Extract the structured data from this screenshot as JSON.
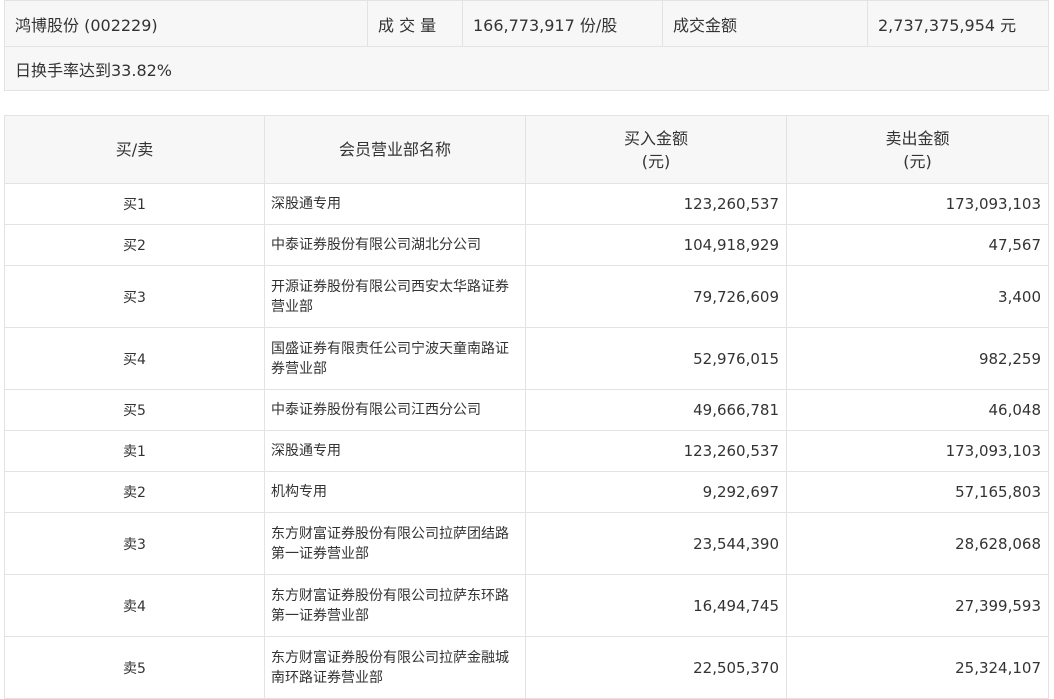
{
  "summary": {
    "stock_name": "鸿博股份 (002229)",
    "volume_label": "成 交 量",
    "volume_value": "166,773,917 份/股",
    "amount_label": "成交金额",
    "amount_value": "2,737,375,954 元",
    "turnover_note": "日换手率达到33.82%"
  },
  "table": {
    "headers": {
      "side": "买/卖",
      "broker": "会员营业部名称",
      "buy_line1": "买入金额",
      "buy_line2": "(元)",
      "sell_line1": "卖出金额",
      "sell_line2": "(元)"
    },
    "rows": [
      {
        "side": "买1",
        "broker": "深股通专用",
        "buy": "123,260,537",
        "sell": "173,093,103"
      },
      {
        "side": "买2",
        "broker": "中泰证券股份有限公司湖北分公司",
        "buy": "104,918,929",
        "sell": "47,567"
      },
      {
        "side": "买3",
        "broker": "开源证券股份有限公司西安太华路证券营业部",
        "buy": "79,726,609",
        "sell": "3,400"
      },
      {
        "side": "买4",
        "broker": "国盛证券有限责任公司宁波天童南路证券营业部",
        "buy": "52,976,015",
        "sell": "982,259"
      },
      {
        "side": "买5",
        "broker": "中泰证券股份有限公司江西分公司",
        "buy": "49,666,781",
        "sell": "46,048"
      },
      {
        "side": "卖1",
        "broker": "深股通专用",
        "buy": "123,260,537",
        "sell": "173,093,103"
      },
      {
        "side": "卖2",
        "broker": "机构专用",
        "buy": "9,292,697",
        "sell": "57,165,803"
      },
      {
        "side": "卖3",
        "broker": "东方财富证券股份有限公司拉萨团结路第一证券营业部",
        "buy": "23,544,390",
        "sell": "28,628,068"
      },
      {
        "side": "卖4",
        "broker": "东方财富证券股份有限公司拉萨东环路第一证券营业部",
        "buy": "16,494,745",
        "sell": "27,399,593"
      },
      {
        "side": "卖5",
        "broker": "东方财富证券股份有限公司拉萨金融城南环路证券营业部",
        "buy": "22,505,370",
        "sell": "25,324,107"
      }
    ]
  }
}
